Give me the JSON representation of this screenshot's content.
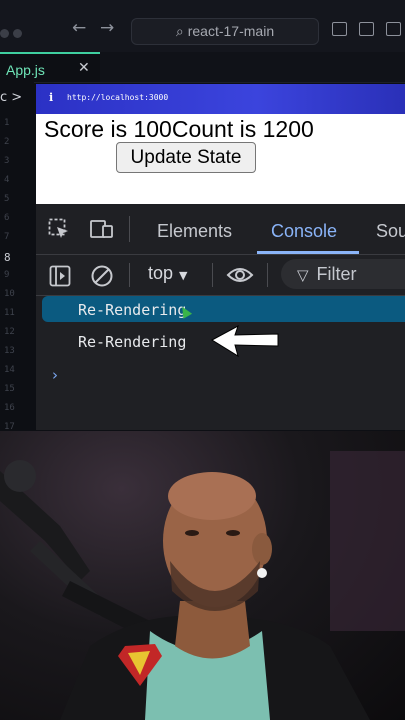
{
  "editor": {
    "search_text": "react-17-main",
    "tab_label": "App.js",
    "tab_close": "✕",
    "breadcrumb": "c >",
    "line_numbers": [
      "1",
      "2",
      "3",
      "4",
      "5",
      "6",
      "7",
      "8",
      "9",
      "10",
      "11",
      "12",
      "13",
      "14",
      "15",
      "16",
      "17"
    ],
    "active_line": "8"
  },
  "browser": {
    "info_glyph": "i",
    "url": "http://localhost:3000",
    "score_line": "Score is 100Count is 1200",
    "update_button": "Update State"
  },
  "devtools": {
    "tabs": [
      "Elements",
      "Console",
      "Sou"
    ],
    "active_tab": "Console",
    "context": "top",
    "filter_placeholder": "Filter",
    "logs": [
      "Re-Rendering",
      "Re-Rendering"
    ],
    "selected_log_index": 0
  },
  "colors": {
    "accent": "#8ab4f8",
    "tab_accent": "#3fd0a0",
    "url_bar": "#3b44dd",
    "selected_row": "#0b5a80"
  },
  "icons": {
    "select_element": "select-element-icon",
    "device_toolbar": "device-toolbar-icon",
    "sidebar": "sidebar-icon",
    "clear": "clear-console-icon",
    "eye": "eye-icon",
    "filter": "filter-icon"
  }
}
